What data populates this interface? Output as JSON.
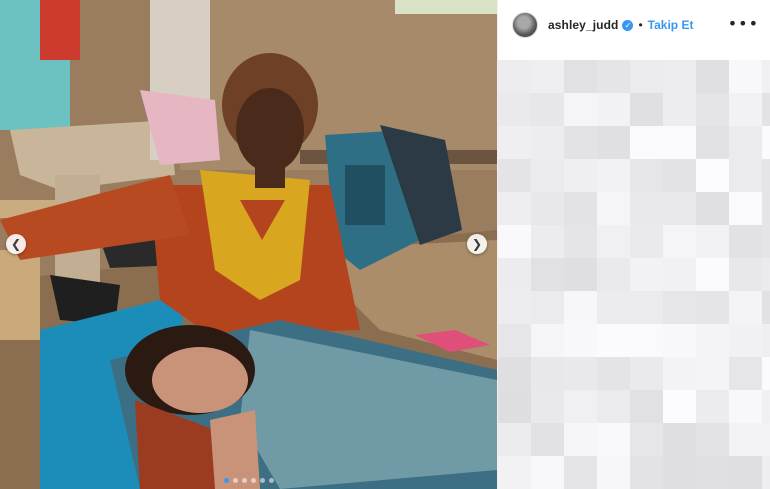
{
  "post": {
    "image": {
      "description_icon": "photo-icon"
    },
    "carousel": {
      "dot_count": 6,
      "active_index": 0
    },
    "nav": {
      "prev_glyph": "❮",
      "next_glyph": "❯"
    }
  },
  "header": {
    "username": "ashley_judd",
    "verified_glyph": "✓",
    "separator": "•",
    "follow_label": "Takip Et",
    "more_glyph": "•••"
  },
  "colors": {
    "accent": "#3897f0",
    "text": "#262626"
  }
}
